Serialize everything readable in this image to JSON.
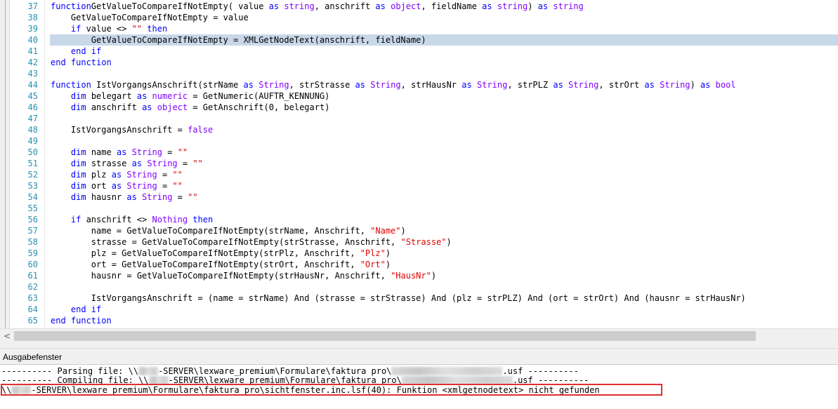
{
  "editor": {
    "highlighted_line": "40",
    "lines": [
      {
        "n": "37",
        "t": [
          [
            "kw",
            "function"
          ],
          [
            "",
            "GetValueToCompareIfNotEmpty( value "
          ],
          [
            "kw",
            "as"
          ],
          [
            "",
            ""
          ],
          [
            "ty",
            "string"
          ],
          [
            "",
            ", anschrift "
          ],
          [
            "kw",
            "as"
          ],
          [
            "",
            ""
          ],
          [
            "ty",
            "object"
          ],
          [
            "",
            ", fieldName "
          ],
          [
            "kw",
            "as"
          ],
          [
            "",
            ""
          ],
          [
            "ty",
            "string"
          ],
          [
            "",
            ") "
          ],
          [
            "kw",
            "as"
          ],
          [
            "",
            ""
          ],
          [
            "ty",
            "string"
          ]
        ]
      },
      {
        "n": "38",
        "t": [
          [
            "",
            "    GetValueToCompareIfNotEmpty = value"
          ]
        ]
      },
      {
        "n": "39",
        "t": [
          [
            "",
            "    "
          ],
          [
            "kw",
            "if"
          ],
          [
            "",
            " value <> "
          ],
          [
            "st",
            "\"\""
          ],
          [
            "",
            ""
          ],
          [
            "kw",
            "then"
          ]
        ]
      },
      {
        "n": "40",
        "t": [
          [
            "",
            "        GetValueToCompareIfNotEmpty = XMLGetNodeText(anschrift, fieldName)"
          ]
        ]
      },
      {
        "n": "41",
        "t": [
          [
            "",
            "    "
          ],
          [
            "kw",
            "end if"
          ]
        ]
      },
      {
        "n": "42",
        "t": [
          [
            "kw",
            "end function"
          ]
        ]
      },
      {
        "n": "43",
        "t": []
      },
      {
        "n": "44",
        "t": [
          [
            "kw",
            "function"
          ],
          [
            "",
            " IstVorgangsAnschrift(strName "
          ],
          [
            "kw",
            "as"
          ],
          [
            "",
            ""
          ],
          [
            "ty",
            "String"
          ],
          [
            "",
            ", strStrasse "
          ],
          [
            "kw",
            "as"
          ],
          [
            "",
            ""
          ],
          [
            "ty",
            "String"
          ],
          [
            "",
            ", strHausNr "
          ],
          [
            "kw",
            "as"
          ],
          [
            "",
            ""
          ],
          [
            "ty",
            "String"
          ],
          [
            "",
            ", strPLZ "
          ],
          [
            "kw",
            "as"
          ],
          [
            "",
            ""
          ],
          [
            "ty",
            "String"
          ],
          [
            "",
            ", strOrt "
          ],
          [
            "kw",
            "as"
          ],
          [
            "",
            ""
          ],
          [
            "ty",
            "String"
          ],
          [
            "",
            ") "
          ],
          [
            "kw",
            "as"
          ],
          [
            "",
            ""
          ],
          [
            "ty",
            "bool"
          ]
        ]
      },
      {
        "n": "45",
        "t": [
          [
            "",
            "    "
          ],
          [
            "kw",
            "dim"
          ],
          [
            "",
            " belegart "
          ],
          [
            "kw",
            "as"
          ],
          [
            "",
            ""
          ],
          [
            "ty",
            "numeric"
          ],
          [
            "",
            " = GetNumeric(AUFTR_KENNUNG)"
          ]
        ]
      },
      {
        "n": "46",
        "t": [
          [
            "",
            "    "
          ],
          [
            "kw",
            "dim"
          ],
          [
            "",
            " anschrift "
          ],
          [
            "kw",
            "as"
          ],
          [
            "",
            ""
          ],
          [
            "ty",
            "object"
          ],
          [
            "",
            " = GetAnschrift(0, belegart)"
          ]
        ]
      },
      {
        "n": "47",
        "t": []
      },
      {
        "n": "48",
        "t": [
          [
            "",
            "    IstVorgangsAnschrift = "
          ],
          [
            "ty",
            "false"
          ]
        ]
      },
      {
        "n": "49",
        "t": []
      },
      {
        "n": "50",
        "t": [
          [
            "",
            "    "
          ],
          [
            "kw",
            "dim"
          ],
          [
            "",
            " name "
          ],
          [
            "kw",
            "as"
          ],
          [
            "",
            ""
          ],
          [
            "ty",
            "String"
          ],
          [
            "",
            " = "
          ],
          [
            "st",
            "\"\""
          ]
        ]
      },
      {
        "n": "51",
        "t": [
          [
            "",
            "    "
          ],
          [
            "kw",
            "dim"
          ],
          [
            "",
            " strasse "
          ],
          [
            "kw",
            "as"
          ],
          [
            "",
            ""
          ],
          [
            "ty",
            "String"
          ],
          [
            "",
            " = "
          ],
          [
            "st",
            "\"\""
          ]
        ]
      },
      {
        "n": "52",
        "t": [
          [
            "",
            "    "
          ],
          [
            "kw",
            "dim"
          ],
          [
            "",
            " plz "
          ],
          [
            "kw",
            "as"
          ],
          [
            "",
            ""
          ],
          [
            "ty",
            "String"
          ],
          [
            "",
            " = "
          ],
          [
            "st",
            "\"\""
          ]
        ]
      },
      {
        "n": "53",
        "t": [
          [
            "",
            "    "
          ],
          [
            "kw",
            "dim"
          ],
          [
            "",
            " ort "
          ],
          [
            "kw",
            "as"
          ],
          [
            "",
            ""
          ],
          [
            "ty",
            "String"
          ],
          [
            "",
            " = "
          ],
          [
            "st",
            "\"\""
          ]
        ]
      },
      {
        "n": "54",
        "t": [
          [
            "",
            "    "
          ],
          [
            "kw",
            "dim"
          ],
          [
            "",
            " hausnr "
          ],
          [
            "kw",
            "as"
          ],
          [
            "",
            ""
          ],
          [
            "ty",
            "String"
          ],
          [
            "",
            " = "
          ],
          [
            "st",
            "\"\""
          ]
        ]
      },
      {
        "n": "55",
        "t": []
      },
      {
        "n": "56",
        "t": [
          [
            "",
            "    "
          ],
          [
            "kw",
            "if"
          ],
          [
            "",
            " anschrift <> "
          ],
          [
            "ty",
            "Nothing"
          ],
          [
            "",
            ""
          ],
          [
            "kw",
            "then"
          ]
        ]
      },
      {
        "n": "57",
        "t": [
          [
            "",
            "        name = GetValueToCompareIfNotEmpty(strName, Anschrift, "
          ],
          [
            "st",
            "\"Name\""
          ],
          [
            "",
            ")"
          ]
        ]
      },
      {
        "n": "58",
        "t": [
          [
            "",
            "        strasse = GetValueToCompareIfNotEmpty(strStrasse, Anschrift, "
          ],
          [
            "st",
            "\"Strasse\""
          ],
          [
            "",
            ")"
          ]
        ]
      },
      {
        "n": "59",
        "t": [
          [
            "",
            "        plz = GetValueToCompareIfNotEmpty(strPlz, Anschrift, "
          ],
          [
            "st",
            "\"Plz\""
          ],
          [
            "",
            ")"
          ]
        ]
      },
      {
        "n": "60",
        "t": [
          [
            "",
            "        ort = GetValueToCompareIfNotEmpty(strOrt, Anschrift, "
          ],
          [
            "st",
            "\"Ort\""
          ],
          [
            "",
            ")"
          ]
        ]
      },
      {
        "n": "61",
        "t": [
          [
            "",
            "        hausnr = GetValueToCompareIfNotEmpty(strHausNr, Anschrift, "
          ],
          [
            "st",
            "\"HausNr\""
          ],
          [
            "",
            ")"
          ]
        ]
      },
      {
        "n": "62",
        "t": []
      },
      {
        "n": "63",
        "t": [
          [
            "",
            "        IstVorgangsAnschrift = (name = strName) And (strasse = strStrasse) And (plz = strPLZ) And (ort = strOrt) And (hausnr = strHausNr)"
          ]
        ]
      },
      {
        "n": "64",
        "t": [
          [
            "",
            "    "
          ],
          [
            "kw",
            "end if"
          ]
        ]
      },
      {
        "n": "65",
        "t": [
          [
            "kw",
            "end function"
          ]
        ]
      }
    ]
  },
  "scrollbar": {
    "left_arrow": "<"
  },
  "output_panel": {
    "title": "Ausgabefenster",
    "lines": [
      {
        "prefix": "---------- Parsing file: \\\\",
        "redacted1": true,
        "mid": "-SERVER\\lexware_premium\\Formulare\\faktura pro\\",
        "redacted2": true,
        "suffix": ".usf ----------"
      },
      {
        "prefix": "---------- Compiling file: \\\\",
        "redacted1": true,
        "mid": "-SERVER\\lexware_premium\\Formulare\\faktura pro\\",
        "redacted2": true,
        "suffix": ".usf ----------"
      },
      {
        "prefix": "\\\\",
        "redacted1": true,
        "mid": "-SERVER\\lexware_premium\\Formulare\\faktura pro\\sichtfenster.inc.lsf(40): Funktion <xmlgetnodetext> nicht gefunden",
        "redacted2": false,
        "suffix": ""
      }
    ]
  }
}
